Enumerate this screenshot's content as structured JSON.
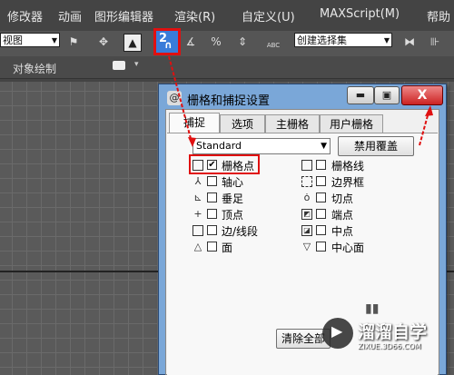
{
  "menubar": {
    "items": [
      "修改器",
      "动画",
      "图形编辑器",
      "渲染(R)",
      "自定义(U)",
      "MAXScript(M)",
      "帮助"
    ]
  },
  "toolbar": {
    "view_select": "视图",
    "snap_button_label": "2",
    "percent_icon": "%",
    "abc_label": "ABC",
    "selection_set_select": "创建选择集"
  },
  "subbar": {
    "label": "对象绘制"
  },
  "dialog": {
    "title": "栅格和捕捉设置",
    "tabs": [
      "捕捉",
      "选项",
      "主栅格",
      "用户栅格"
    ],
    "active_tab": "捕捉",
    "standard_select": "Standard",
    "override_button": "禁用覆盖",
    "clear_all_button": "清除全部",
    "close_glyph": "X",
    "left_items": [
      {
        "label": "栅格点",
        "checked": true,
        "icon": "grid-point-icon"
      },
      {
        "label": "轴心",
        "checked": false,
        "icon": "pivot-icon"
      },
      {
        "label": "垂足",
        "checked": false,
        "icon": "perpendicular-icon"
      },
      {
        "label": "顶点",
        "checked": false,
        "icon": "vertex-icon"
      },
      {
        "label": "边/线段",
        "checked": false,
        "icon": "edge-icon"
      },
      {
        "label": "面",
        "checked": false,
        "icon": "face-icon"
      }
    ],
    "right_items": [
      {
        "label": "栅格线",
        "checked": false,
        "icon": "grid-line-icon"
      },
      {
        "label": "边界框",
        "checked": false,
        "icon": "bounding-box-icon"
      },
      {
        "label": "切点",
        "checked": false,
        "icon": "tangent-icon"
      },
      {
        "label": "端点",
        "checked": false,
        "icon": "endpoint-icon"
      },
      {
        "label": "中点",
        "checked": false,
        "icon": "midpoint-icon"
      },
      {
        "label": "中心面",
        "checked": false,
        "icon": "center-face-icon"
      }
    ]
  },
  "watermark": {
    "title": "溜溜自学",
    "subtitle": "ZIXUE.3D66.COM"
  },
  "colors": {
    "annotation_red": "#e01010",
    "snap_button_blue": "#3a7cd9",
    "dialog_frame": "#7aa7d8"
  }
}
